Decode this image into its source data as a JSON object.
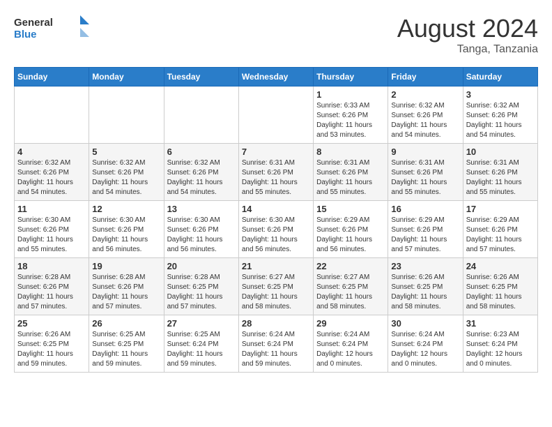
{
  "header": {
    "logo_general": "General",
    "logo_blue": "Blue",
    "month_title": "August 2024",
    "location": "Tanga, Tanzania"
  },
  "weekdays": [
    "Sunday",
    "Monday",
    "Tuesday",
    "Wednesday",
    "Thursday",
    "Friday",
    "Saturday"
  ],
  "weeks": [
    [
      {
        "day": "",
        "info": ""
      },
      {
        "day": "",
        "info": ""
      },
      {
        "day": "",
        "info": ""
      },
      {
        "day": "",
        "info": ""
      },
      {
        "day": "1",
        "info": "Sunrise: 6:33 AM\nSunset: 6:26 PM\nDaylight: 11 hours\nand 53 minutes."
      },
      {
        "day": "2",
        "info": "Sunrise: 6:32 AM\nSunset: 6:26 PM\nDaylight: 11 hours\nand 54 minutes."
      },
      {
        "day": "3",
        "info": "Sunrise: 6:32 AM\nSunset: 6:26 PM\nDaylight: 11 hours\nand 54 minutes."
      }
    ],
    [
      {
        "day": "4",
        "info": "Sunrise: 6:32 AM\nSunset: 6:26 PM\nDaylight: 11 hours\nand 54 minutes."
      },
      {
        "day": "5",
        "info": "Sunrise: 6:32 AM\nSunset: 6:26 PM\nDaylight: 11 hours\nand 54 minutes."
      },
      {
        "day": "6",
        "info": "Sunrise: 6:32 AM\nSunset: 6:26 PM\nDaylight: 11 hours\nand 54 minutes."
      },
      {
        "day": "7",
        "info": "Sunrise: 6:31 AM\nSunset: 6:26 PM\nDaylight: 11 hours\nand 55 minutes."
      },
      {
        "day": "8",
        "info": "Sunrise: 6:31 AM\nSunset: 6:26 PM\nDaylight: 11 hours\nand 55 minutes."
      },
      {
        "day": "9",
        "info": "Sunrise: 6:31 AM\nSunset: 6:26 PM\nDaylight: 11 hours\nand 55 minutes."
      },
      {
        "day": "10",
        "info": "Sunrise: 6:31 AM\nSunset: 6:26 PM\nDaylight: 11 hours\nand 55 minutes."
      }
    ],
    [
      {
        "day": "11",
        "info": "Sunrise: 6:30 AM\nSunset: 6:26 PM\nDaylight: 11 hours\nand 55 minutes."
      },
      {
        "day": "12",
        "info": "Sunrise: 6:30 AM\nSunset: 6:26 PM\nDaylight: 11 hours\nand 56 minutes."
      },
      {
        "day": "13",
        "info": "Sunrise: 6:30 AM\nSunset: 6:26 PM\nDaylight: 11 hours\nand 56 minutes."
      },
      {
        "day": "14",
        "info": "Sunrise: 6:30 AM\nSunset: 6:26 PM\nDaylight: 11 hours\nand 56 minutes."
      },
      {
        "day": "15",
        "info": "Sunrise: 6:29 AM\nSunset: 6:26 PM\nDaylight: 11 hours\nand 56 minutes."
      },
      {
        "day": "16",
        "info": "Sunrise: 6:29 AM\nSunset: 6:26 PM\nDaylight: 11 hours\nand 57 minutes."
      },
      {
        "day": "17",
        "info": "Sunrise: 6:29 AM\nSunset: 6:26 PM\nDaylight: 11 hours\nand 57 minutes."
      }
    ],
    [
      {
        "day": "18",
        "info": "Sunrise: 6:28 AM\nSunset: 6:26 PM\nDaylight: 11 hours\nand 57 minutes."
      },
      {
        "day": "19",
        "info": "Sunrise: 6:28 AM\nSunset: 6:26 PM\nDaylight: 11 hours\nand 57 minutes."
      },
      {
        "day": "20",
        "info": "Sunrise: 6:28 AM\nSunset: 6:25 PM\nDaylight: 11 hours\nand 57 minutes."
      },
      {
        "day": "21",
        "info": "Sunrise: 6:27 AM\nSunset: 6:25 PM\nDaylight: 11 hours\nand 58 minutes."
      },
      {
        "day": "22",
        "info": "Sunrise: 6:27 AM\nSunset: 6:25 PM\nDaylight: 11 hours\nand 58 minutes."
      },
      {
        "day": "23",
        "info": "Sunrise: 6:26 AM\nSunset: 6:25 PM\nDaylight: 11 hours\nand 58 minutes."
      },
      {
        "day": "24",
        "info": "Sunrise: 6:26 AM\nSunset: 6:25 PM\nDaylight: 11 hours\nand 58 minutes."
      }
    ],
    [
      {
        "day": "25",
        "info": "Sunrise: 6:26 AM\nSunset: 6:25 PM\nDaylight: 11 hours\nand 59 minutes."
      },
      {
        "day": "26",
        "info": "Sunrise: 6:25 AM\nSunset: 6:25 PM\nDaylight: 11 hours\nand 59 minutes."
      },
      {
        "day": "27",
        "info": "Sunrise: 6:25 AM\nSunset: 6:24 PM\nDaylight: 11 hours\nand 59 minutes."
      },
      {
        "day": "28",
        "info": "Sunrise: 6:24 AM\nSunset: 6:24 PM\nDaylight: 11 hours\nand 59 minutes."
      },
      {
        "day": "29",
        "info": "Sunrise: 6:24 AM\nSunset: 6:24 PM\nDaylight: 12 hours\nand 0 minutes."
      },
      {
        "day": "30",
        "info": "Sunrise: 6:24 AM\nSunset: 6:24 PM\nDaylight: 12 hours\nand 0 minutes."
      },
      {
        "day": "31",
        "info": "Sunrise: 6:23 AM\nSunset: 6:24 PM\nDaylight: 12 hours\nand 0 minutes."
      }
    ]
  ]
}
